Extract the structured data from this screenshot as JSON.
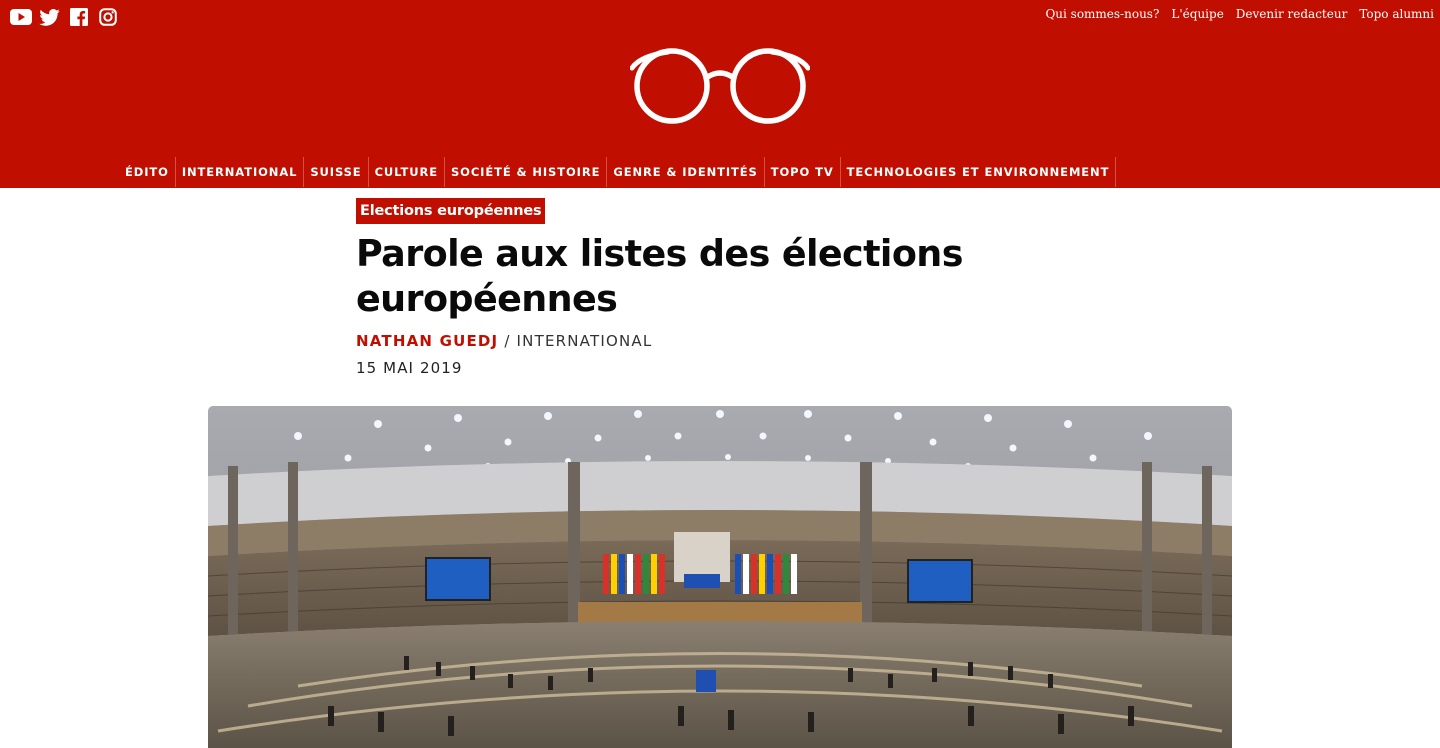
{
  "header": {
    "social": [
      {
        "icon": "youtube-icon"
      },
      {
        "icon": "twitter-icon"
      },
      {
        "icon": "facebook-icon"
      },
      {
        "icon": "instagram-icon"
      }
    ],
    "top_links": [
      "Qui sommes-nous?",
      "L'équipe",
      "Devenir redacteur",
      "Topo alumni"
    ],
    "logo": {
      "icon": "glasses-logo-icon"
    },
    "nav": [
      "ÉDITO",
      "INTERNATIONAL",
      "SUISSE",
      "CULTURE",
      "SOCIÉTÉ & HISTOIRE",
      "GENRE & IDENTITÉS",
      "TOPO TV",
      "TECHNOLOGIES ET ENVIRONNEMENT"
    ]
  },
  "article": {
    "category": "Elections européennes",
    "title": "Parole aux listes des élections européennes",
    "author": "NATHAN GUEDJ",
    "separator": "/",
    "section": "INTERNATIONAL",
    "date": "15 MAI 2019"
  },
  "image": {
    "subject": "european-parliament-hemicycle-photo"
  },
  "colors": {
    "brand_red": "#c00f00",
    "text": "#0a0a0a",
    "white": "#ffffff"
  }
}
